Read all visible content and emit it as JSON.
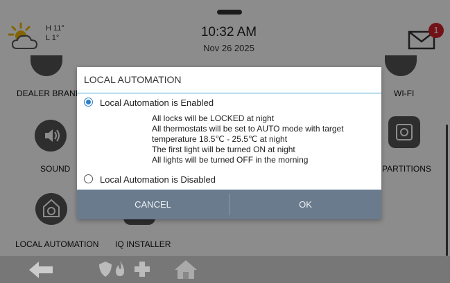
{
  "header": {
    "temp_high": "H 11°",
    "temp_low": "L 1°",
    "time": "10:32 AM",
    "date": "Nov 26 2025",
    "message_count": "1"
  },
  "tiles": {
    "dealer_brand": "DEALER BRAND",
    "wifi": "WI-FI",
    "sound": "SOUND",
    "partitions": "PARTITIONS",
    "local_automation": "LOCAL AUTOMATION",
    "iq_installer": "IQ INSTALLER"
  },
  "dialog": {
    "title": "LOCAL AUTOMATION",
    "option_enabled": "Local Automation is Enabled",
    "details": [
      "All locks will be LOCKED at night",
      "All thermostats will be set to AUTO mode with target",
      "temperature 18.5℃ - 25.5℃ at night",
      "The first light will be turned ON at night",
      "All lights will be turned OFF in the morning"
    ],
    "option_disabled": "Local Automation is Disabled",
    "selected": "enabled",
    "cancel_label": "CANCEL",
    "ok_label": "OK"
  },
  "colors": {
    "accent": "#2b7fc8",
    "badge": "#d0212b",
    "button_bar": "#6a7b8d",
    "nav_bar": "#777777"
  },
  "icons": [
    "weather-partly-sunny-icon",
    "mail-icon",
    "back-arrow-icon",
    "security-shield-icon",
    "fire-icon",
    "medical-cross-icon",
    "home-icon"
  ]
}
